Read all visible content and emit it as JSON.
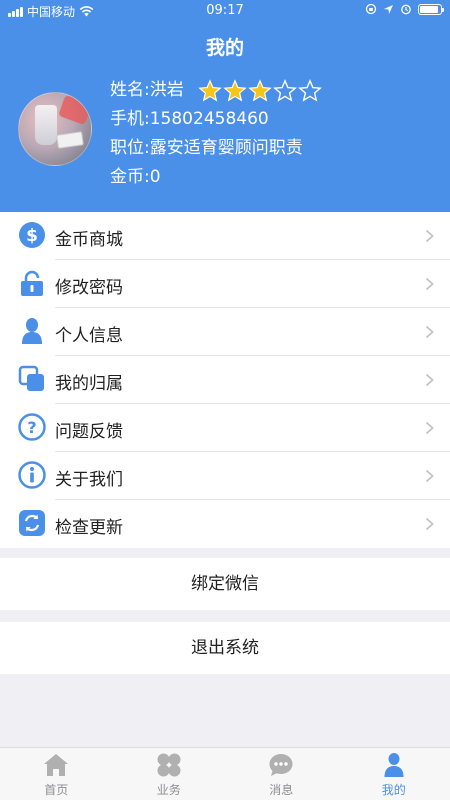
{
  "status_bar": {
    "carrier": "中国移动",
    "time": "09:17"
  },
  "header": {
    "title": "我的"
  },
  "profile": {
    "name_label": "姓名: ",
    "name": "洪岩",
    "stars_filled": 3,
    "stars_total": 5,
    "phone_label": "手机: ",
    "phone": "15802458460",
    "position_label": "职位: ",
    "position": "露安适育婴顾问职责",
    "coins_label": "金币: ",
    "coins": "0"
  },
  "menu": {
    "items": [
      {
        "label": "金币商城",
        "icon": "dollar-icon"
      },
      {
        "label": "修改密码",
        "icon": "lock-icon"
      },
      {
        "label": "个人信息",
        "icon": "person-icon"
      },
      {
        "label": "我的归属",
        "icon": "overlap-squares-icon"
      },
      {
        "label": "问题反馈",
        "icon": "question-icon"
      },
      {
        "label": "关于我们",
        "icon": "info-icon"
      },
      {
        "label": "检查更新",
        "icon": "refresh-icon"
      }
    ]
  },
  "actions": {
    "bind_wechat": "绑定微信",
    "logout": "退出系统"
  },
  "tabbar": {
    "tabs": [
      {
        "label": "首页",
        "icon": "home-icon"
      },
      {
        "label": "业务",
        "icon": "clover-icon"
      },
      {
        "label": "消息",
        "icon": "chat-icon"
      },
      {
        "label": "我的",
        "icon": "user-icon"
      }
    ],
    "active_index": 3
  },
  "colors": {
    "accent": "#4a90e8",
    "star_fill": "#f5c518",
    "inactive_tab": "#b0b0b0"
  }
}
